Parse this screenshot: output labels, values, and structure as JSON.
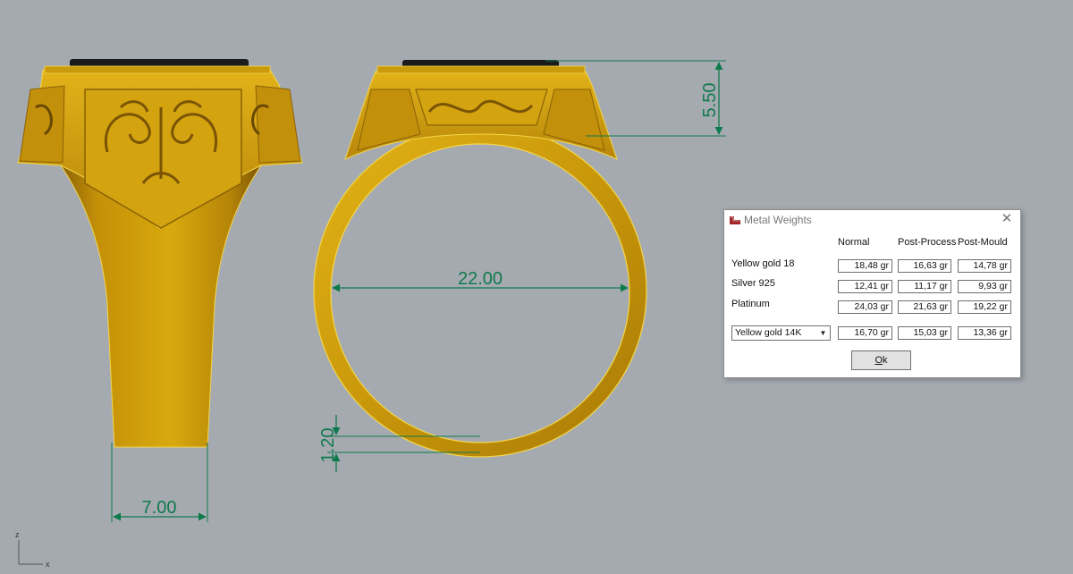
{
  "viewport": {
    "dimensions": {
      "top_height": "5.50",
      "ring_diameter": "22.00",
      "band_thickness": "1.20",
      "shank_width": "7.00"
    },
    "axes": {
      "z": "z",
      "x": "x"
    }
  },
  "dialog": {
    "title": "Metal Weights",
    "columns": [
      "Normal",
      "Post-Process",
      "Post-Mould"
    ],
    "rows": [
      {
        "label": "Yellow gold 18",
        "values": [
          "18,48 gr",
          "16,63 gr",
          "14,78 gr"
        ]
      },
      {
        "label": "Silver 925",
        "values": [
          "12,41 gr",
          "11,17 gr",
          "9,93 gr"
        ]
      },
      {
        "label": "Platinum",
        "values": [
          "24,03 gr",
          "21,63 gr",
          "19,22 gr"
        ]
      }
    ],
    "custom_row": {
      "selected_metal": "Yellow gold 14K",
      "values": [
        "16,70 gr",
        "15,03 gr",
        "13,36 gr"
      ]
    },
    "ok_label_underlined": "O",
    "ok_label_rest": "k"
  },
  "colors": {
    "background": "#a5aab1",
    "gold": "#d9a70e",
    "dimension": "#0f7a4c"
  }
}
